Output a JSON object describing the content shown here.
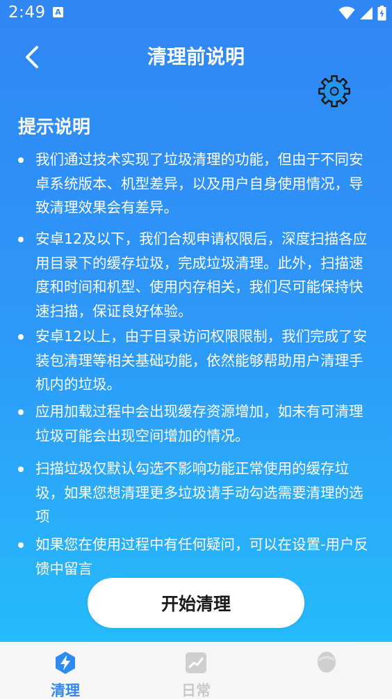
{
  "status_bar": {
    "time": "2:49",
    "notification_icon": "A"
  },
  "header": {
    "title": "清理前说明"
  },
  "section": {
    "title": "提示说明"
  },
  "tips": [
    {
      "text": "我们通过技术实现了垃圾清理的功能，但由于不同安卓系统版本、机型差异，以及用户自身使用情况，导致清理效果会有差异。"
    },
    {
      "text": "安卓12及以下，我们合规申请权限后，深度扫描各应用目录下的缓存垃圾，完成垃圾清理。此外，扫描速度和时间和机型、使用内存相关，我们尽可能保持快速扫描，保证良好体验。"
    },
    {
      "text": "安卓12以上，由于目录访问权限限制，我们完成了安装包清理等相关基础功能，依然能够帮助用户清理手机内的垃圾。"
    },
    {
      "text": "应用加载过程中会出现缓存资源增加，如未有可清理垃圾可能会出现空间增加的情况。"
    },
    {
      "text": "扫描垃圾仅默认勾选不影响功能正常使用的缓存垃圾，如果您想清理更多垃圾请手动勾选需要清理的选项"
    },
    {
      "text": "如果您在使用过程中有任何疑问，可以在设置-用户反馈中留言"
    }
  ],
  "start_button": {
    "label": "开始清理"
  },
  "bottom_nav": {
    "items": [
      {
        "label": "清理",
        "icon": "lightning-bolt-icon",
        "active": true
      },
      {
        "label": "日常",
        "icon": "trend-chart-icon",
        "active": false
      },
      {
        "label": "",
        "icon": "profile-icon",
        "active": false
      }
    ]
  },
  "colors": {
    "accent": "#2d8bf3",
    "gradient_top": "#2f86f4",
    "gradient_bottom": "#22c3fd",
    "gear_fill": "#2196f3",
    "nav_background": "#f6f6f6",
    "nav_inactive": "#c9c9c9"
  }
}
